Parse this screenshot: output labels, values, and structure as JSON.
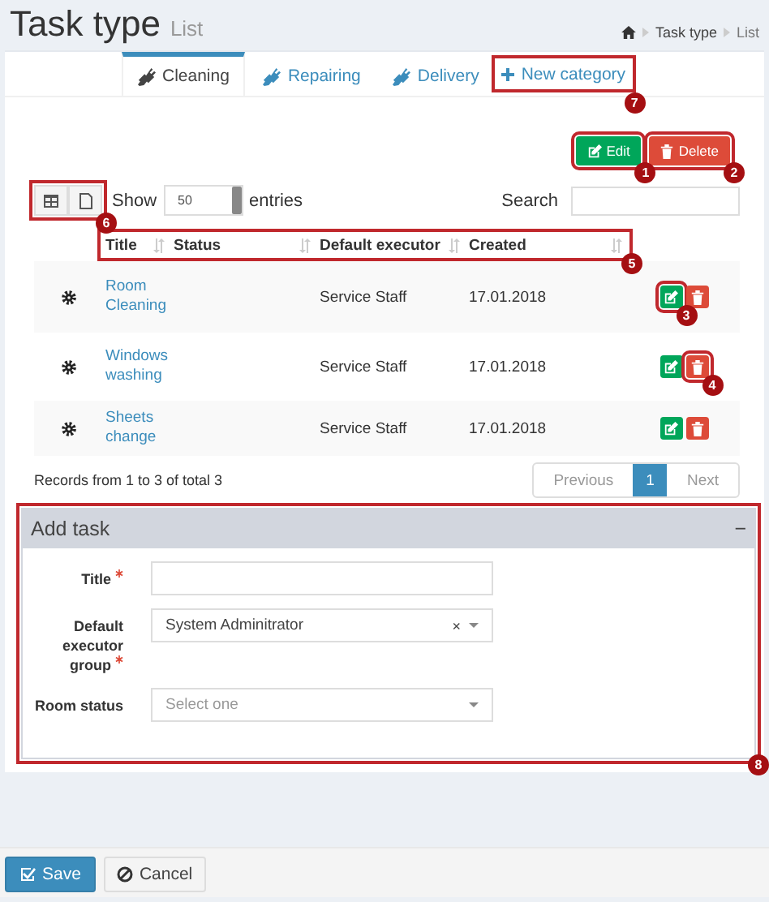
{
  "header": {
    "title": "Task type",
    "subtitle": "List",
    "breadcrumb": [
      "Task type",
      "List"
    ]
  },
  "tabs": [
    {
      "label": "Cleaning",
      "selected": true,
      "kind": "category"
    },
    {
      "label": "Repairing",
      "selected": false,
      "kind": "category"
    },
    {
      "label": "Delivery",
      "selected": false,
      "kind": "category"
    },
    {
      "label": "New category",
      "selected": false,
      "kind": "add",
      "callout": "7"
    }
  ],
  "actions": [
    {
      "label": "Edit",
      "kind": "edit",
      "callout": "1"
    },
    {
      "label": "Delete",
      "kind": "delete",
      "callout": "2"
    }
  ],
  "export_tools": {
    "callout": "6"
  },
  "length_menu": {
    "before": "Show",
    "value": "50",
    "after": "entries"
  },
  "search": {
    "label": "Search"
  },
  "table": {
    "header_callout": "5",
    "columns": [
      "Title",
      "Status",
      "Default executor",
      "Created"
    ],
    "rows": [
      {
        "title": "Room Cleaning",
        "executor": "Service Staff",
        "created": "17.01.2018",
        "actions": [
          {
            "kind": "edit",
            "callout": "3"
          },
          {
            "kind": "delete"
          }
        ]
      },
      {
        "title": "Windows washing",
        "executor": "Service Staff",
        "created": "17.01.2018",
        "actions": [
          {
            "kind": "edit"
          },
          {
            "kind": "delete",
            "callout": "4"
          }
        ]
      },
      {
        "title": "Sheets change",
        "executor": "Service Staff",
        "created": "17.01.2018",
        "actions": [
          {
            "kind": "edit"
          },
          {
            "kind": "delete"
          }
        ]
      }
    ]
  },
  "info": "Records from 1 to 3 of total 3",
  "pagination": [
    {
      "label": "Previous",
      "selected": false,
      "disabled": true
    },
    {
      "label": "1",
      "selected": true,
      "disabled": false
    },
    {
      "label": "Next",
      "selected": false,
      "disabled": true
    }
  ],
  "add_task": {
    "title": "Add task",
    "collapse": "−",
    "callout": "8",
    "fields": [
      {
        "label": "Title",
        "required": true,
        "kind": "text"
      },
      {
        "label": "Default executor group",
        "required": true,
        "kind": "select",
        "value": "System Adminitrator",
        "clear": "×"
      },
      {
        "label": "Room status",
        "required": false,
        "kind": "select",
        "placeholder": "Select one"
      }
    ]
  },
  "footer": [
    {
      "label": "Save",
      "kind": "primary"
    },
    {
      "label": "Cancel",
      "kind": "default"
    }
  ]
}
